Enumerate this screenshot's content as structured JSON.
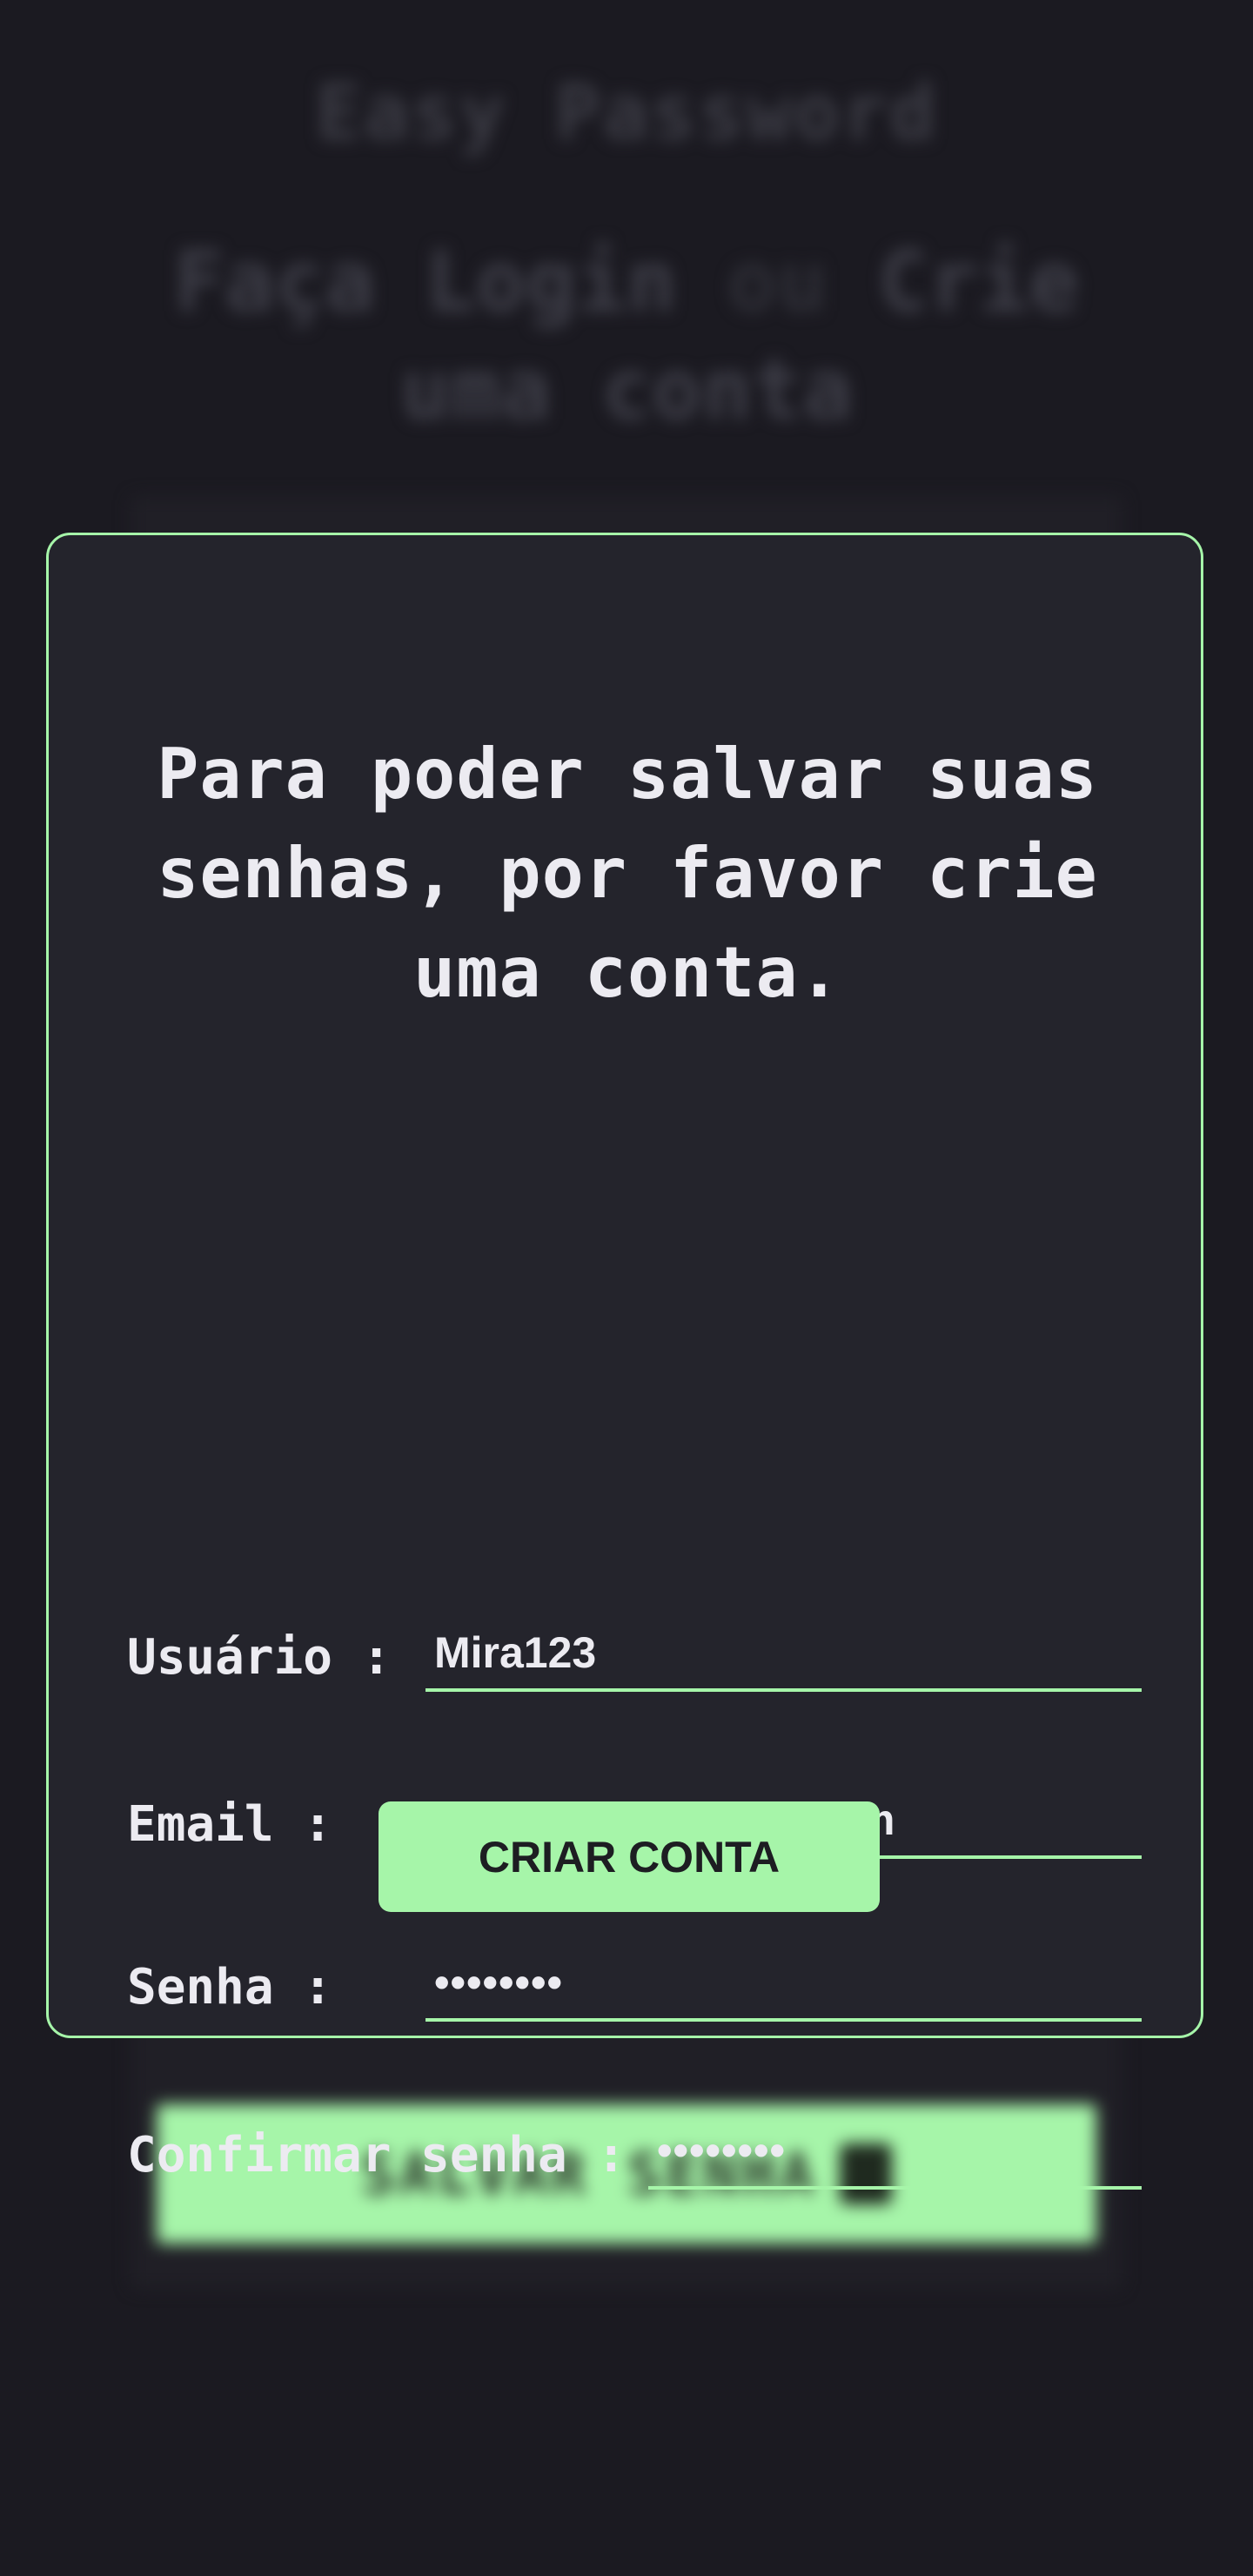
{
  "background": {
    "app_title": "Easy Password",
    "subtitle_part1": "Faça Login",
    "subtitle_part2": "ou",
    "subtitle_part3": "Crie uma conta",
    "save_button_label": "SALVAR SENHA",
    "save_button_icon": "lock-icon"
  },
  "modal": {
    "title": "Para poder salvar suas senhas, por favor crie uma conta.",
    "fields": {
      "username": {
        "label": "Usuário :",
        "value": "Mira123"
      },
      "email": {
        "label": "Email :",
        "value": "Mira123@hotmail.com"
      },
      "password": {
        "label": "Senha :",
        "value": "••••••••"
      },
      "confirm_password": {
        "label": "Confirmar senha :",
        "value": "••••••••"
      }
    },
    "submit_label": "CRIAR CONTA"
  },
  "colors": {
    "background": "#1b1a21",
    "modal_background": "#24242c",
    "accent": "#a6f5a9",
    "text": "#ecebf1"
  }
}
